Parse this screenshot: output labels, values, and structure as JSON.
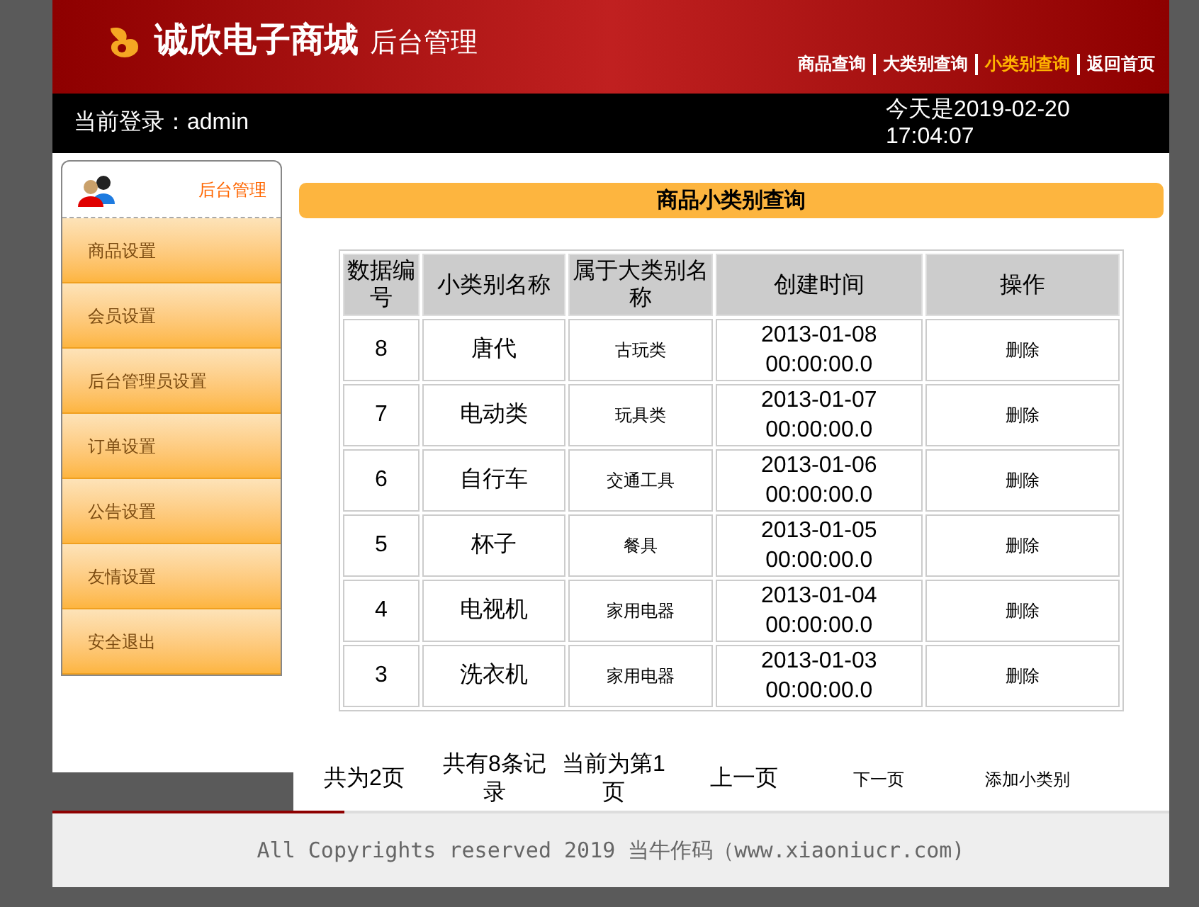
{
  "header": {
    "logo_text": "诚欣电子商城",
    "subtitle": "后台管理",
    "nav": [
      {
        "label": "商品查询",
        "selected": false
      },
      {
        "label": "大类别查询",
        "selected": false
      },
      {
        "label": "小类别查询",
        "selected": true
      },
      {
        "label": "返回首页",
        "selected": false
      }
    ]
  },
  "info_bar": {
    "login": "当前登录：admin",
    "date": "今天是2019-02-20 17:04:07"
  },
  "sidebar": {
    "title": "后台管理",
    "items": [
      "商品设置",
      "会员设置",
      "后台管理员设置",
      "订单设置",
      "公告设置",
      "友情设置",
      "安全退出"
    ]
  },
  "panel": {
    "title": "商品小类别查询"
  },
  "table": {
    "columns": [
      "数据编号",
      "小类别名称",
      "属于大类别名称",
      "创建时间",
      "操作"
    ],
    "rows": [
      {
        "id": "8",
        "name": "唐代",
        "parent": "古玩类",
        "created": "2013-01-08 00:00:00.0",
        "action": "删除"
      },
      {
        "id": "7",
        "name": "电动类",
        "parent": "玩具类",
        "created": "2013-01-07 00:00:00.0",
        "action": "删除"
      },
      {
        "id": "6",
        "name": "自行车",
        "parent": "交通工具",
        "created": "2013-01-06 00:00:00.0",
        "action": "删除"
      },
      {
        "id": "5",
        "name": "杯子",
        "parent": "餐具",
        "created": "2013-01-05 00:00:00.0",
        "action": "删除"
      },
      {
        "id": "4",
        "name": "电视机",
        "parent": "家用电器",
        "created": "2013-01-04 00:00:00.0",
        "action": "删除"
      },
      {
        "id": "3",
        "name": "洗衣机",
        "parent": "家用电器",
        "created": "2013-01-03 00:00:00.0",
        "action": "删除"
      }
    ]
  },
  "pagination": [
    {
      "kind": "info",
      "label": "共为2页"
    },
    {
      "kind": "info",
      "label": "共有8条记录"
    },
    {
      "kind": "info",
      "label": "当前为第1页"
    },
    {
      "kind": "info",
      "label": "上一页"
    },
    {
      "kind": "link",
      "label": "下一页"
    },
    {
      "kind": "link",
      "label": "添加小类别"
    }
  ],
  "footer": "All Copyrights reserved 2019 当牛作码（www.xiaoniucr.com)"
}
